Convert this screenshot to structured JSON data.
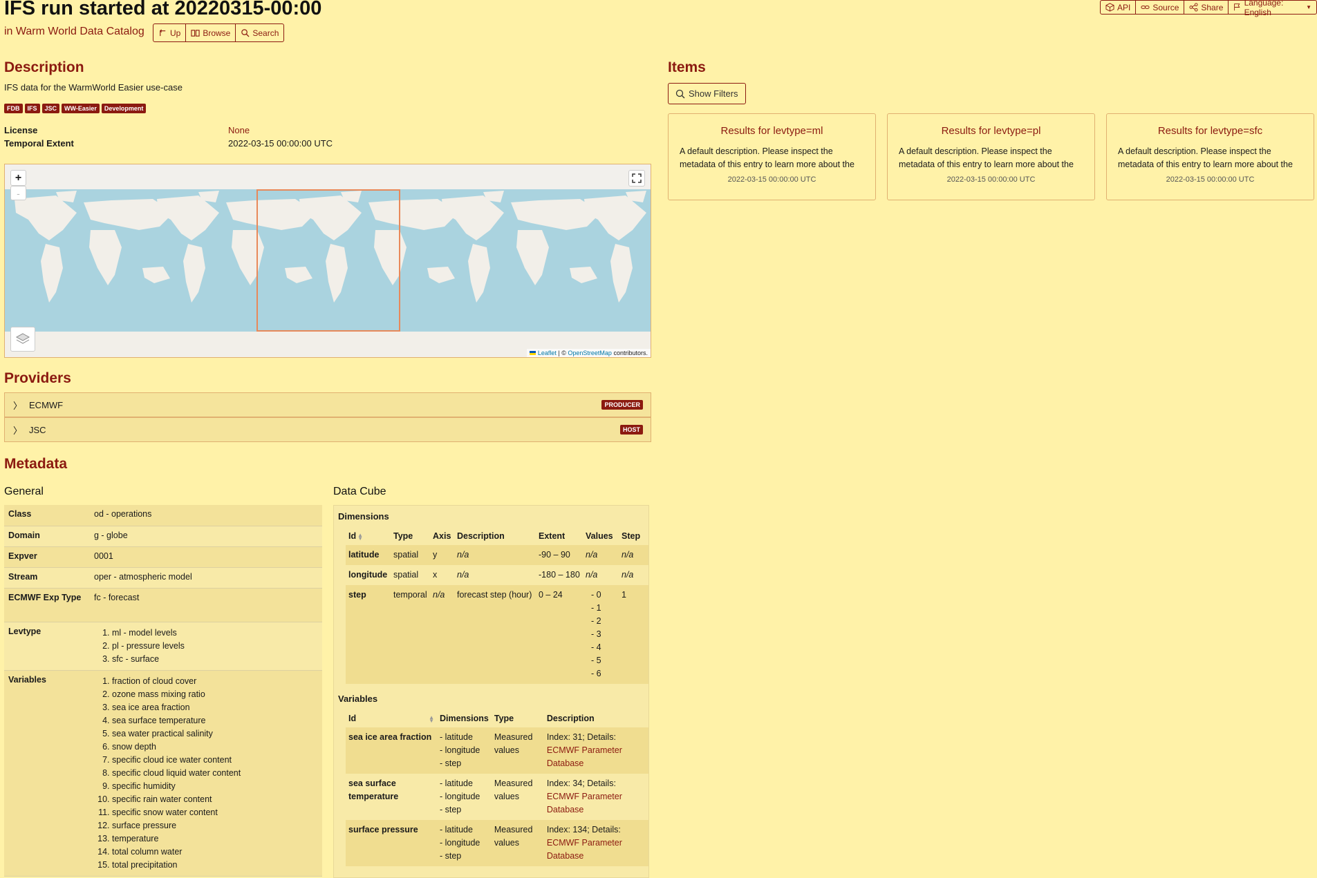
{
  "header": {
    "title": "IFS run started at 20220315-00:00",
    "catalog_link": "in Warm World Data Catalog",
    "nav_buttons": {
      "up": "Up",
      "browse": "Browse",
      "search": "Search"
    },
    "top_buttons": {
      "api": "API",
      "source": "Source",
      "share": "Share",
      "language": "Language: English"
    }
  },
  "description": {
    "heading": "Description",
    "text": "IFS data for the WarmWorld Easier use-case",
    "keywords": [
      "FDB",
      "IFS",
      "JSC",
      "WW-Easier",
      "Development"
    ],
    "license_label": "License",
    "license_value": "None",
    "temporal_label": "Temporal Extent",
    "temporal_value": "2022-03-15 00:00:00 UTC"
  },
  "map": {
    "zoom_in": "+",
    "zoom_out": "-",
    "attribution_leaflet": "Leaflet",
    "attribution_mid": "| ©",
    "attribution_osm": "OpenStreetMap",
    "attribution_end": "contributors."
  },
  "providers": {
    "heading": "Providers",
    "items": [
      {
        "name": "ECMWF",
        "role": "PRODUCER"
      },
      {
        "name": "JSC",
        "role": "HOST"
      }
    ]
  },
  "items_section": {
    "heading": "Items",
    "filter_button": "Show Filters",
    "cards": [
      {
        "title": "Results for levtype=ml",
        "desc": "A default description. Please inspect the metadata of this entry to learn more about the data.",
        "date": "2022-03-15 00:00:00 UTC"
      },
      {
        "title": "Results for levtype=pl",
        "desc": "A default description. Please inspect the metadata of this entry to learn more about the data.",
        "date": "2022-03-15 00:00:00 UTC"
      },
      {
        "title": "Results for levtype=sfc",
        "desc": "A default description. Please inspect the metadata of this entry to learn more about the data.",
        "date": "2022-03-15 00:00:00 UTC"
      }
    ]
  },
  "metadata": {
    "heading": "Metadata",
    "general_heading": "General",
    "general": {
      "class_label": "Class",
      "class_value": "od - operations",
      "domain_label": "Domain",
      "domain_value": "g - globe",
      "expver_label": "Expver",
      "expver_value": "0001",
      "stream_label": "Stream",
      "stream_value": "oper - atmospheric model",
      "exptype_label": "ECMWF Exp Type",
      "exptype_value": "fc - forecast",
      "levtype_label": "Levtype",
      "levtypes": [
        "ml - model levels",
        "pl - pressure levels",
        "sfc - surface"
      ],
      "variables_label": "Variables",
      "variables": [
        "fraction of cloud cover",
        "ozone mass mixing ratio",
        "sea ice area fraction",
        "sea surface temperature",
        "sea water practical salinity",
        "snow depth",
        "specific cloud ice water content",
        "specific cloud liquid water content",
        "specific humidity",
        "specific rain water content",
        "specific snow water content",
        "surface pressure",
        "temperature",
        "total column water",
        "total precipitation"
      ]
    },
    "cube_heading": "Data Cube",
    "cube": {
      "dimensions_label": "Dimensions",
      "dim_headers": [
        "Id",
        "Type",
        "Axis",
        "Description",
        "Extent",
        "Values",
        "Step"
      ],
      "dims": [
        {
          "id": "latitude",
          "type": "spatial",
          "axis": "y",
          "desc": "n/a",
          "extent": "-90 – 90",
          "values": "n/a",
          "step": "n/a"
        },
        {
          "id": "longitude",
          "type": "spatial",
          "axis": "x",
          "desc": "n/a",
          "extent": "-180 – 180",
          "values": "n/a",
          "step": "n/a"
        },
        {
          "id": "step",
          "type": "temporal",
          "axis": "n/a",
          "desc": "forecast step (hour)",
          "extent": "0 – 24",
          "values": [
            "- 0",
            "- 1",
            "- 2",
            "- 3",
            "- 4",
            "- 5",
            "- 6"
          ],
          "step": "1"
        }
      ],
      "variables_label": "Variables",
      "var_headers": [
        "Id",
        "Dimensions",
        "Type",
        "Description"
      ],
      "vars": [
        {
          "id": "sea ice area fraction",
          "dims": [
            "- latitude",
            "- longitude",
            "- step"
          ],
          "type": "Measured values",
          "desc": "Index: 31; Details:",
          "link": "ECMWF Parameter Database"
        },
        {
          "id": "sea surface temperature",
          "dims": [
            "- latitude",
            "- longitude",
            "- step"
          ],
          "type": "Measured values",
          "desc": "Index: 34; Details:",
          "link": "ECMWF Parameter Database"
        },
        {
          "id": "surface pressure",
          "dims": [
            "- latitude",
            "- longitude",
            "- step"
          ],
          "type": "Measured values",
          "desc": "Index: 134; Details:",
          "link": "ECMWF Parameter Database"
        }
      ]
    }
  },
  "colors": {
    "background": "#fff2a8",
    "accent": "#8b1a10",
    "ocean": "#aad3df",
    "bbox": "#e8895a"
  }
}
